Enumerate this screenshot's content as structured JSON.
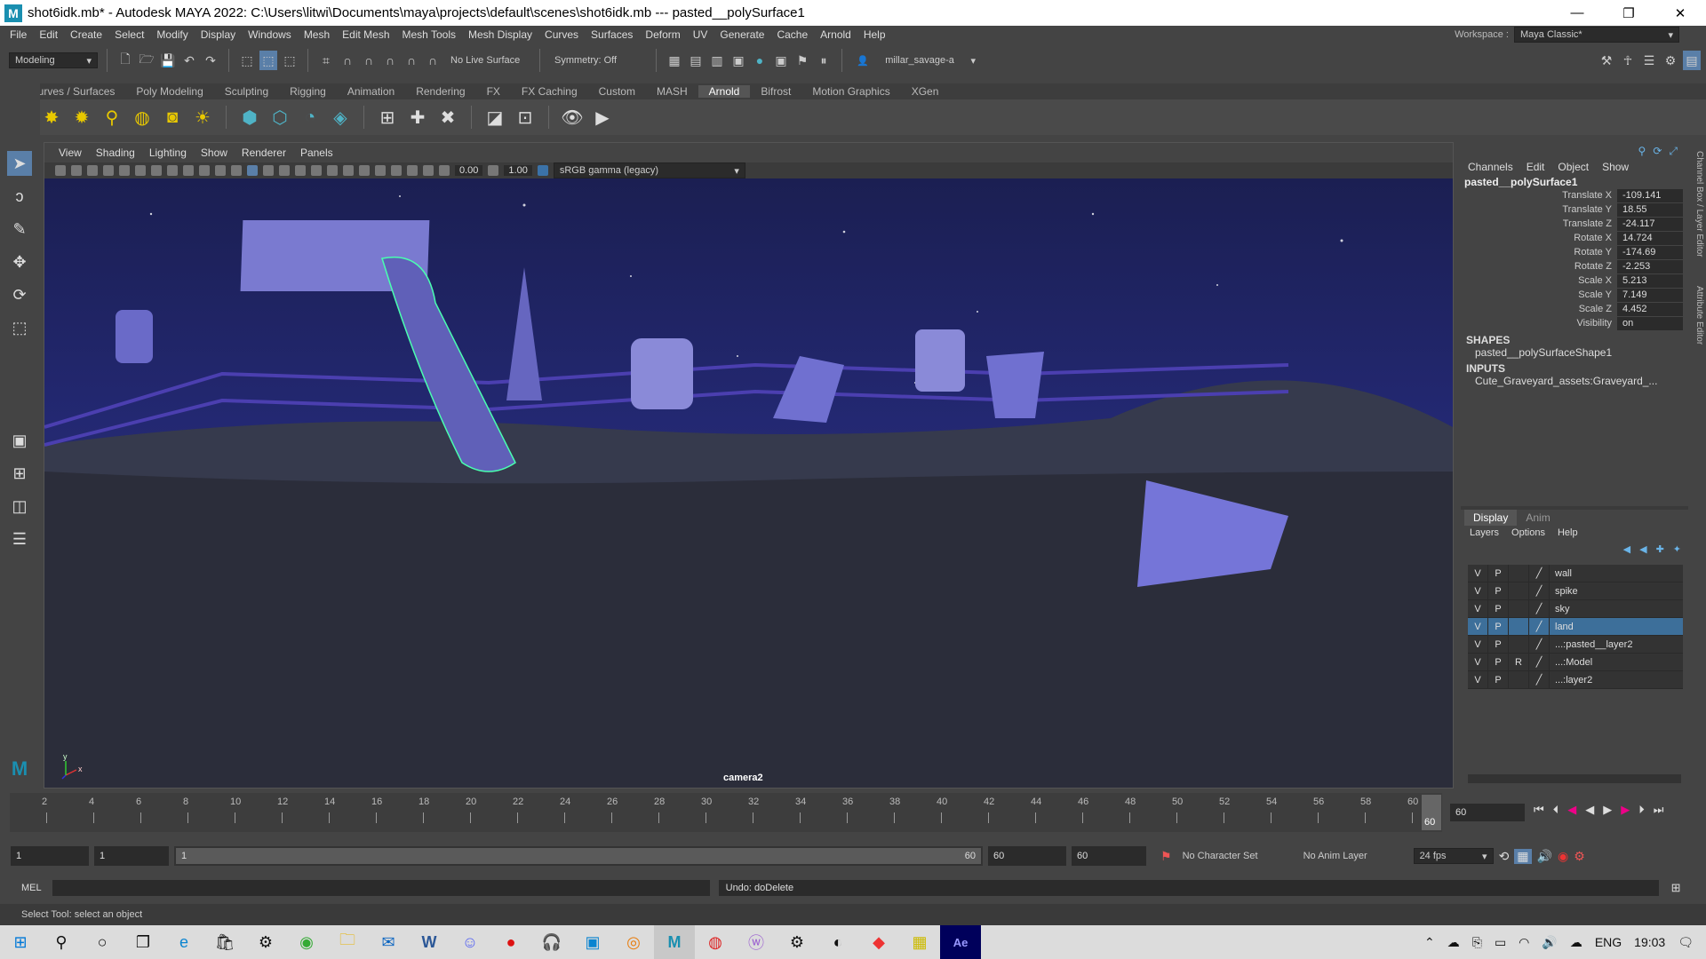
{
  "title": {
    "text": "shot6idk.mb* - Autodesk MAYA 2022: C:\\Users\\litwi\\Documents\\maya\\projects\\default\\scenes\\shot6idk.mb   ---   pasted__polySurface1",
    "minimize": "—",
    "restore": "❐",
    "close": "✕"
  },
  "menu": [
    "File",
    "Edit",
    "Create",
    "Select",
    "Modify",
    "Display",
    "Windows",
    "Mesh",
    "Edit Mesh",
    "Mesh Tools",
    "Mesh Display",
    "Curves",
    "Surfaces",
    "Deform",
    "UV",
    "Generate",
    "Cache",
    "Arnold",
    "Help"
  ],
  "workspace": {
    "label": "Workspace :",
    "value": "Maya Classic*"
  },
  "status": {
    "mode": "Modeling",
    "live_surface": "No Live Surface",
    "symmetry": "Symmetry: Off",
    "user": "millar_savage-a"
  },
  "shelf_tabs": [
    "Curves / Surfaces",
    "Poly Modeling",
    "Sculpting",
    "Rigging",
    "Animation",
    "Rendering",
    "FX",
    "FX Caching",
    "Custom",
    "MASH",
    "Arnold",
    "Bifrost",
    "Motion Graphics",
    "XGen"
  ],
  "shelf_active": "Arnold",
  "viewport": {
    "menu": [
      "View",
      "Shading",
      "Lighting",
      "Show",
      "Renderer",
      "Panels"
    ],
    "exposure": "0.00",
    "gamma": "1.00",
    "colorspace": "sRGB gamma (legacy)",
    "camera": "camera2",
    "axis_y": "y",
    "axis_x": "x"
  },
  "channel_box": {
    "menu": [
      "Channels",
      "Edit",
      "Object",
      "Show"
    ],
    "object": "pasted__polySurface1",
    "attrs": [
      {
        "name": "Translate X",
        "value": "-109.141"
      },
      {
        "name": "Translate Y",
        "value": "18.55"
      },
      {
        "name": "Translate Z",
        "value": "-24.117"
      },
      {
        "name": "Rotate X",
        "value": "14.724"
      },
      {
        "name": "Rotate Y",
        "value": "-174.69"
      },
      {
        "name": "Rotate Z",
        "value": "-2.253"
      },
      {
        "name": "Scale X",
        "value": "5.213"
      },
      {
        "name": "Scale Y",
        "value": "7.149"
      },
      {
        "name": "Scale Z",
        "value": "4.452"
      },
      {
        "name": "Visibility",
        "value": "on"
      }
    ],
    "shapes_label": "SHAPES",
    "shape": "pasted__polySurfaceShape1",
    "inputs_label": "INPUTS",
    "input": "Cute_Graveyard_assets:Graveyard_...",
    "side_tab_1": "Channel Box / Layer Editor",
    "side_tab_2": "Attribute Editor"
  },
  "layer_editor": {
    "tabs": [
      "Display",
      "Anim"
    ],
    "menu": [
      "Layers",
      "Options",
      "Help"
    ],
    "layers": [
      {
        "v": "V",
        "p": "P",
        "r": "",
        "name": "wall",
        "selected": false
      },
      {
        "v": "V",
        "p": "P",
        "r": "",
        "name": "spike",
        "selected": false
      },
      {
        "v": "V",
        "p": "P",
        "r": "",
        "name": "sky",
        "selected": false
      },
      {
        "v": "V",
        "p": "P",
        "r": "",
        "name": "land",
        "selected": true
      },
      {
        "v": "V",
        "p": "P",
        "r": "",
        "name": "...:pasted__layer2",
        "selected": false
      },
      {
        "v": "V",
        "p": "P",
        "r": "R",
        "name": "...:Model",
        "selected": false
      },
      {
        "v": "V",
        "p": "P",
        "r": "",
        "name": "...:layer2",
        "selected": false
      }
    ]
  },
  "timeline": {
    "ticks": [
      "2",
      "4",
      "6",
      "8",
      "10",
      "12",
      "14",
      "16",
      "18",
      "20",
      "22",
      "24",
      "26",
      "28",
      "30",
      "32",
      "34",
      "36",
      "38",
      "40",
      "42",
      "44",
      "46",
      "48",
      "50",
      "52",
      "54",
      "56",
      "58",
      "60"
    ],
    "current_frame": "60",
    "current_field": "60"
  },
  "range": {
    "start": "1",
    "playback_start": "1",
    "slider_start": "1",
    "slider_end": "60",
    "playback_end": "60",
    "end": "60",
    "character_set": "No Character Set",
    "anim_layer": "No Anim Layer",
    "fps": "24 fps"
  },
  "cmdline": {
    "lang": "MEL",
    "result": "Undo: doDelete"
  },
  "helpline": "Select Tool: select an object",
  "taskbar": {
    "lang": "ENG",
    "time": "19:03"
  }
}
